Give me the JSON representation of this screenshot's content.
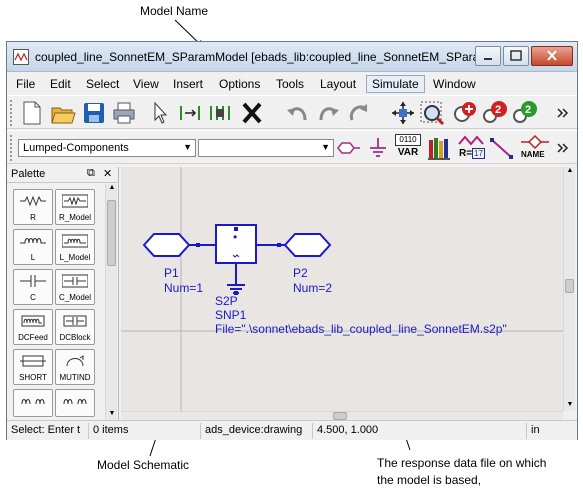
{
  "callouts": {
    "model_name": "Model Name",
    "model_schematic": "Model Schematic",
    "response_file_line1": "The response data file on which",
    "response_file_line2": "the model is based,"
  },
  "window": {
    "title": "coupled_line_SonnetEM_SParamModel [ebads_lib:coupled_line_SonnetEM_SParam...",
    "icon": "ads-schematic-icon"
  },
  "menubar": {
    "items": [
      "File",
      "Edit",
      "Select",
      "View",
      "Insert",
      "Options",
      "Tools",
      "Layout",
      "Simulate",
      "Window"
    ]
  },
  "toolbar2": {
    "library_combo": "Lumped-Components",
    "second_combo": "",
    "var_badge_top": "0110",
    "var_badge_bottom": "VAR",
    "r_label": "R=",
    "r_value": "17",
    "name_label": "NAME"
  },
  "palette": {
    "title": "Palette",
    "items": [
      {
        "label": "R",
        "icon": "resistor-icon"
      },
      {
        "label": "R_Model",
        "icon": "resistor-model-icon"
      },
      {
        "label": "L",
        "icon": "inductor-icon"
      },
      {
        "label": "L_Model",
        "icon": "inductor-model-icon"
      },
      {
        "label": "C",
        "icon": "capacitor-icon"
      },
      {
        "label": "C_Model",
        "icon": "capacitor-model-icon"
      },
      {
        "label": "DCFeed",
        "icon": "dcfeed-icon"
      },
      {
        "label": "DCBlock",
        "icon": "dcblock-icon"
      },
      {
        "label": "SHORT",
        "icon": "short-icon"
      },
      {
        "label": "MUTIND",
        "icon": "mutind-icon"
      }
    ]
  },
  "schematic": {
    "p1_name": "P1",
    "p1_num": "Num=1",
    "p2_name": "P2",
    "p2_num": "Num=2",
    "snp_id": "S2P",
    "snp_name": "SNP1",
    "snp_file": "File=\".\\sonnet\\ebads_lib_coupled_line_SonnetEM.s2p\"",
    "color": "#1a1acc"
  },
  "statusbar": {
    "hint": "Select: Enter t",
    "items": "0 items",
    "context": "ads_device:drawing",
    "coords": "4.500, 1.000",
    "units": "in"
  }
}
